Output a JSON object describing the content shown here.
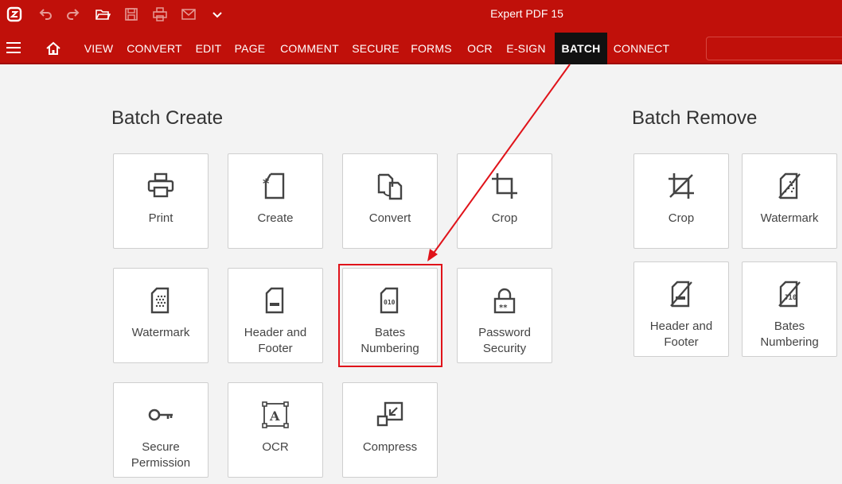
{
  "app": {
    "title": "Expert PDF 15"
  },
  "quick_access": [
    {
      "name": "app-logo-icon"
    },
    {
      "name": "undo-icon"
    },
    {
      "name": "redo-icon"
    },
    {
      "name": "open-folder-icon"
    },
    {
      "name": "save-icon"
    },
    {
      "name": "print-icon"
    },
    {
      "name": "email-icon"
    },
    {
      "name": "chevron-down-icon"
    }
  ],
  "ribbon": {
    "tabs": [
      "VIEW",
      "CONVERT",
      "EDIT",
      "PAGE",
      "COMMENT",
      "SECURE",
      "FORMS",
      "OCR",
      "E-SIGN",
      "BATCH",
      "CONNECT"
    ],
    "active_tab": "BATCH"
  },
  "batch_create": {
    "title": "Batch Create",
    "items": [
      {
        "label": "Print",
        "icon": "print-icon"
      },
      {
        "label": "Create",
        "icon": "create-document-icon"
      },
      {
        "label": "Convert",
        "icon": "convert-icon"
      },
      {
        "label": "Crop",
        "icon": "crop-icon"
      },
      {
        "label": "Watermark",
        "icon": "watermark-icon"
      },
      {
        "label_line1": "Header and",
        "label_line2": "Footer",
        "icon": "header-footer-icon"
      },
      {
        "label_line1": "Bates",
        "label_line2": "Numbering",
        "icon": "bates-numbering-icon",
        "highlighted": true
      },
      {
        "label_line1": "Password",
        "label_line2": "Security",
        "icon": "lock-icon"
      },
      {
        "label_line1": "Secure",
        "label_line2": "Permission",
        "icon": "key-icon"
      },
      {
        "label": "OCR",
        "icon": "ocr-icon"
      },
      {
        "label": "Compress",
        "icon": "compress-icon"
      }
    ]
  },
  "batch_remove": {
    "title": "Batch Remove",
    "items": [
      {
        "label": "Crop",
        "icon": "remove-crop-icon"
      },
      {
        "label": "Watermark",
        "icon": "remove-watermark-icon"
      },
      {
        "label_line1": "Header and",
        "label_line2": "Footer",
        "icon": "remove-header-footer-icon"
      },
      {
        "label_line1": "Bates",
        "label_line2": "Numbering",
        "icon": "remove-bates-numbering-icon"
      }
    ]
  },
  "annotation": {
    "color": "#e0131a"
  }
}
